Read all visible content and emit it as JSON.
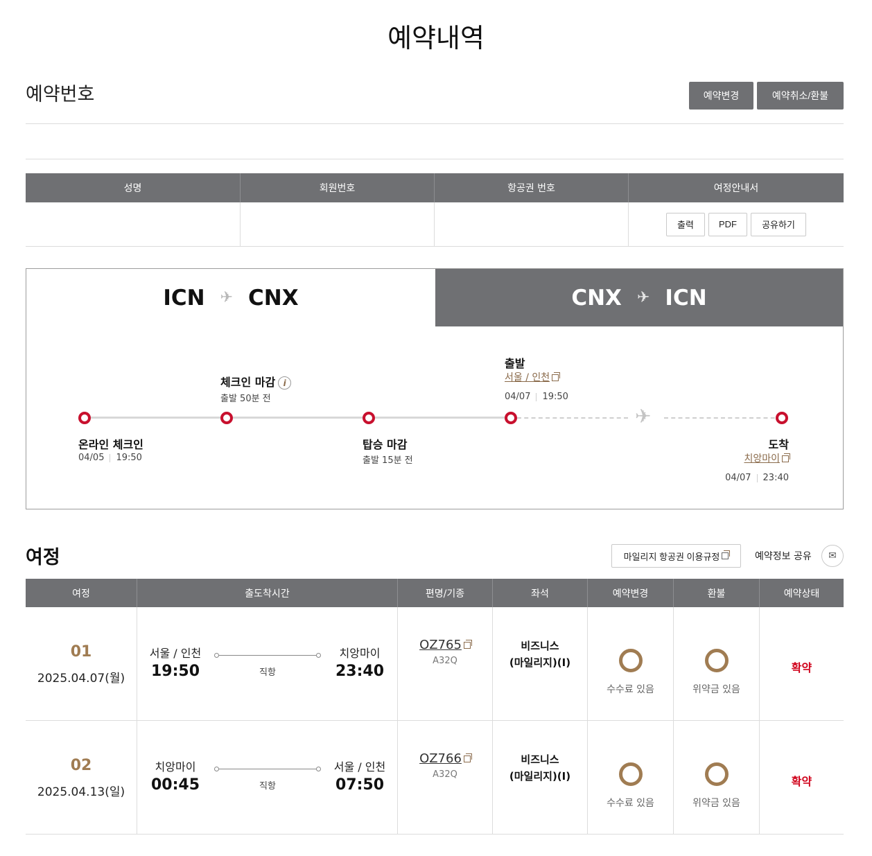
{
  "page_title": "예약내역",
  "reservation": {
    "section_title": "예약번호",
    "change_button": "예약변경",
    "cancel_button": "예약취소/환불"
  },
  "passenger_table": {
    "headers": [
      "성명",
      "회원번호",
      "항공권 번호",
      "여정안내서"
    ],
    "buttons": {
      "print": "출력",
      "pdf": "PDF",
      "share": "공유하기"
    }
  },
  "route_tabs": [
    {
      "from": "ICN",
      "to": "CNX",
      "active": true
    },
    {
      "from": "CNX",
      "to": "ICN",
      "active": false
    }
  ],
  "timeline": {
    "online_checkin": {
      "label": "온라인 체크인",
      "date": "04/05",
      "time": "19:50"
    },
    "checkin_deadline": {
      "label": "체크인 마감",
      "sub": "출발 50분 전"
    },
    "boarding_deadline": {
      "label": "탑승 마감",
      "sub": "출발 15분 전"
    },
    "departure": {
      "label": "출발",
      "city": "서울 / 인천",
      "date": "04/07",
      "time": "19:50"
    },
    "arrival": {
      "label": "도착",
      "city": "치앙마이",
      "date": "04/07",
      "time": "23:40"
    }
  },
  "itinerary": {
    "title": "여정",
    "mileage_rules_button": "마일리지 항공권 이용규정",
    "share_label": "예약정보 공유",
    "headers": [
      "여정",
      "출도착시간",
      "편명/기종",
      "좌석",
      "예약변경",
      "환불",
      "예약상태"
    ],
    "rows": [
      {
        "seq": "01",
        "date": "2025.04.07(월)",
        "dep_city": "서울 / 인천",
        "dep_time": "19:50",
        "arr_city": "치앙마이",
        "arr_time": "23:40",
        "direct": "직항",
        "flight": "OZ765",
        "aircraft": "A32Q",
        "seat_line1": "비즈니스",
        "seat_line2": "(마일리지)(I)",
        "change": "수수료 있음",
        "refund": "위약금 있음",
        "status": "확약"
      },
      {
        "seq": "02",
        "date": "2025.04.13(일)",
        "dep_city": "치앙마이",
        "dep_time": "00:45",
        "arr_city": "서울 / 인천",
        "arr_time": "07:50",
        "direct": "직항",
        "flight": "OZ766",
        "aircraft": "A32Q",
        "seat_line1": "비즈니스",
        "seat_line2": "(마일리지)(I)",
        "change": "수수료 있음",
        "refund": "위약금 있음",
        "status": "확약"
      }
    ]
  },
  "colors": {
    "header_gray": "#6f7073",
    "accent_red": "#c8102e",
    "accent_brown": "#a07c52",
    "status_red": "#d0021b"
  },
  "icons": {
    "plane": "airplane-icon",
    "info": "info-icon",
    "external": "external-link-icon",
    "mail": "mail-icon"
  }
}
